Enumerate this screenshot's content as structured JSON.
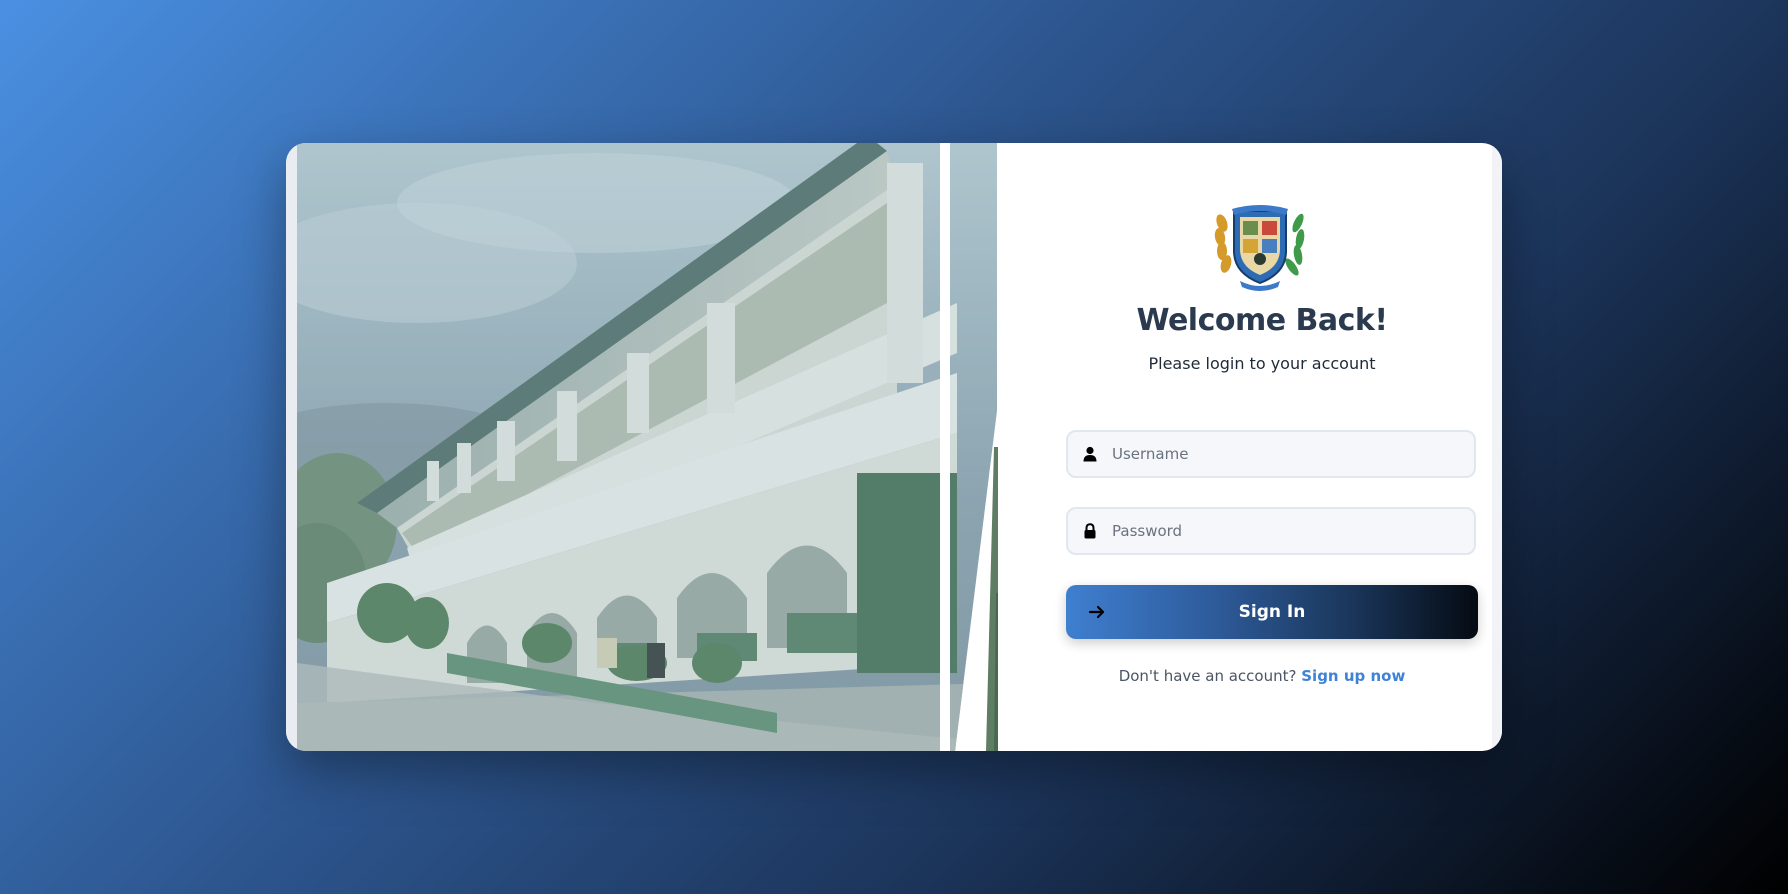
{
  "login": {
    "title": "Welcome Back!",
    "subtitle": "Please login to your account",
    "username": {
      "placeholder": "Username",
      "value": "",
      "icon": "user-icon"
    },
    "password": {
      "placeholder": "Password",
      "value": "",
      "icon": "lock-icon"
    },
    "signin_label": "Sign In",
    "signin_icon": "arrow-right-icon",
    "signup_prompt": "Don't have an account?",
    "signup_link": "Sign up now"
  },
  "colors": {
    "accent": "#3f83d8",
    "title": "#2b3a4e",
    "bg_start": "#4a90e2",
    "bg_end": "#000000"
  }
}
